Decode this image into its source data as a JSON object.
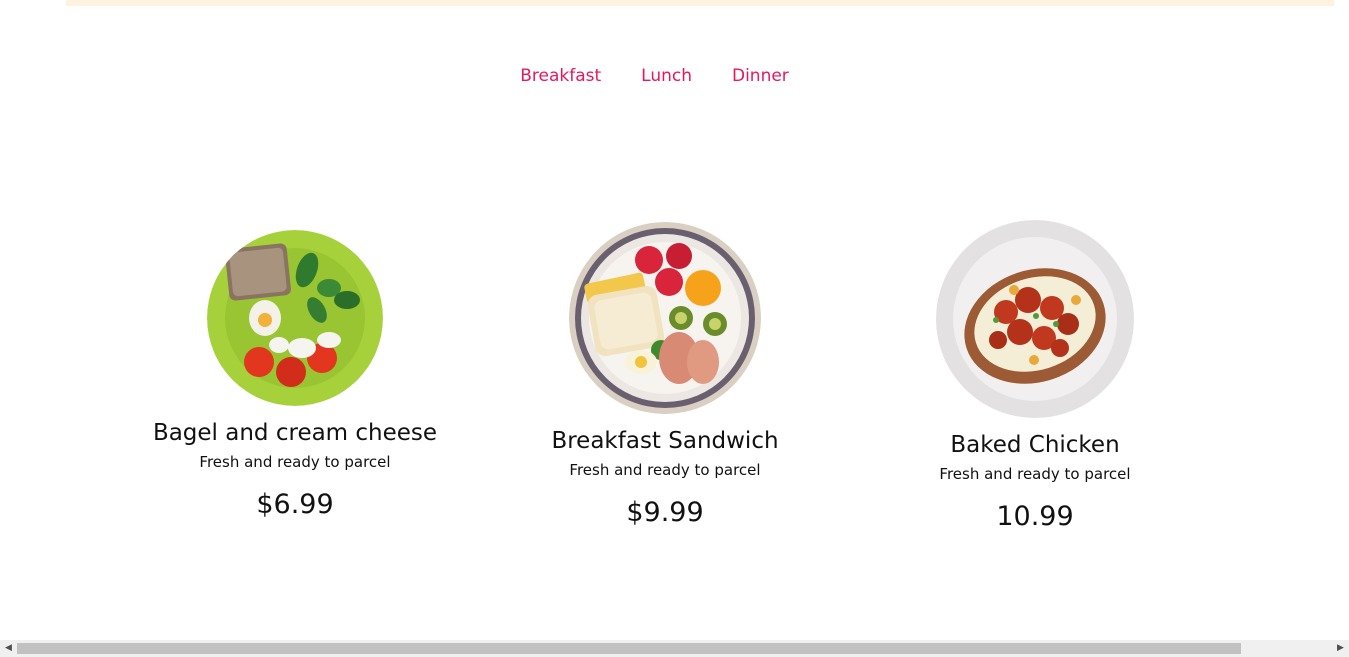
{
  "tabs": [
    {
      "label": "Breakfast"
    },
    {
      "label": "Lunch"
    },
    {
      "label": "Dinner"
    }
  ],
  "menu_items": [
    {
      "title": "Bagel and cream cheese",
      "description": "Fresh and ready to parcel",
      "price": "$6.99",
      "image": "bagel-plate-image"
    },
    {
      "title": "Breakfast Sandwich",
      "description": "Fresh and ready to parcel",
      "price": "$9.99",
      "image": "breakfast-plate-image"
    },
    {
      "title": "Baked Chicken",
      "description": "Fresh and ready to parcel",
      "price": "10.99",
      "image": "baked-chicken-plate-image"
    }
  ],
  "colors": {
    "accent": "#e8175d",
    "banner": "#fdf3e0",
    "text": "#111111"
  },
  "scrollbar": {
    "left_arrow": "◀",
    "right_arrow": "▶"
  }
}
